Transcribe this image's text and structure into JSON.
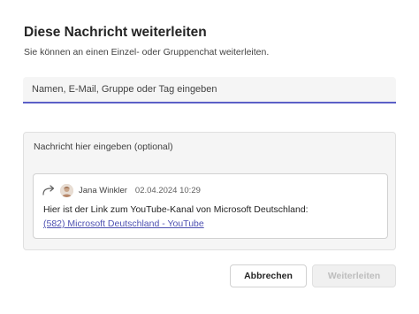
{
  "dialog": {
    "title": "Diese Nachricht weiterleiten",
    "subtitle": "Sie können an einen Einzel- oder Gruppenchat weiterleiten."
  },
  "recipient": {
    "placeholder": "Namen, E-Mail, Gruppe oder Tag eingeben",
    "value": ""
  },
  "message": {
    "placeholder": "Nachricht hier eingeben (optional)"
  },
  "quote": {
    "icon": "forward-arrow-icon",
    "sender": "Jana Winkler",
    "timestamp": "02.04.2024 10:29",
    "text": "Hier ist der Link zum YouTube-Kanal von Microsoft Deutschland:",
    "link_text": "(582) Microsoft Deutschland - YouTube"
  },
  "buttons": {
    "cancel": "Abbrechen",
    "forward": "Weiterleiten",
    "forward_disabled": true
  },
  "colors": {
    "accent": "#5b5fc7",
    "link": "#4f52b2",
    "field_bg": "#f5f5f5",
    "disabled_text": "#bdbdbd"
  }
}
